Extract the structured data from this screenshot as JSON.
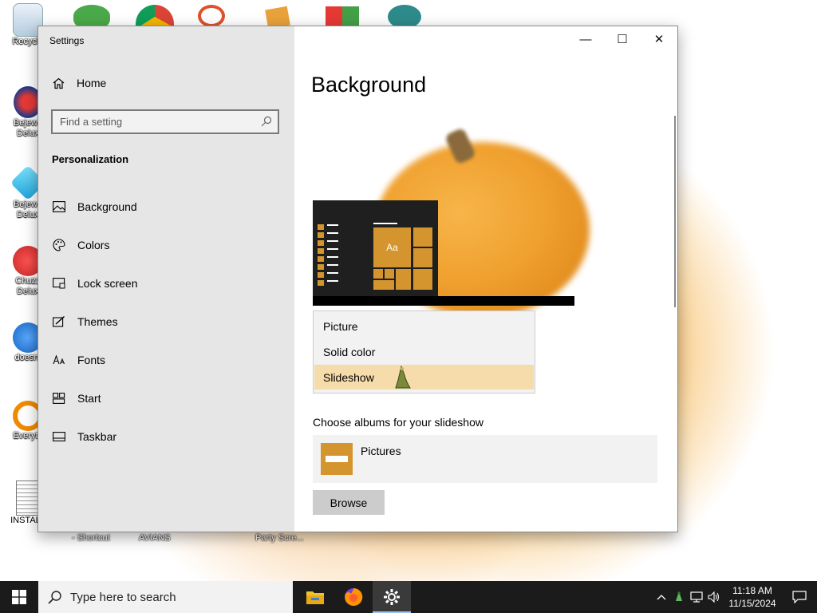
{
  "desktop": {
    "icons": [
      {
        "label": "Recycle"
      },
      {
        "label": "Bejewe\nDelux"
      },
      {
        "label": "Bejewe\nDelux"
      },
      {
        "label": "Chuzz\nDelux"
      },
      {
        "label": "doesnt"
      },
      {
        "label": "Everyth"
      },
      {
        "label": "INSTALL"
      }
    ],
    "bottom_labels": [
      "- Shortcut",
      "AVIANS",
      "Party Scre..."
    ]
  },
  "window": {
    "title": "Settings",
    "minimize_glyph": "—",
    "maximize_glyph": "☐",
    "close_glyph": "✕"
  },
  "sidebar": {
    "home_label": "Home",
    "search_placeholder": "Find a setting",
    "section_title": "Personalization",
    "items": [
      {
        "label": "Background",
        "icon": "background-icon"
      },
      {
        "label": "Colors",
        "icon": "palette-icon"
      },
      {
        "label": "Lock screen",
        "icon": "lock-screen-icon"
      },
      {
        "label": "Themes",
        "icon": "themes-icon"
      },
      {
        "label": "Fonts",
        "icon": "fonts-icon"
      },
      {
        "label": "Start",
        "icon": "start-icon"
      },
      {
        "label": "Taskbar",
        "icon": "taskbar-icon"
      }
    ]
  },
  "main": {
    "title": "Background",
    "preview_tile_text": "Aa",
    "background_options": [
      "Picture",
      "Solid color",
      "Slideshow"
    ],
    "selected_option": "Slideshow",
    "albums_label": "Choose albums for your slideshow",
    "album_name": "Pictures",
    "browse_label": "Browse"
  },
  "taskbar": {
    "search_placeholder": "Type here to search",
    "apps": [
      "file-explorer-icon",
      "firefox-icon",
      "settings-icon"
    ],
    "clock_time": "11:18 AM",
    "clock_date": "11/15/2024"
  },
  "colors": {
    "accent": "#d4952e",
    "selected_option_bg": "#f5dcaa",
    "sidebar_bg": "#e6e6e6",
    "taskbar_bg": "#1b1b1b"
  }
}
